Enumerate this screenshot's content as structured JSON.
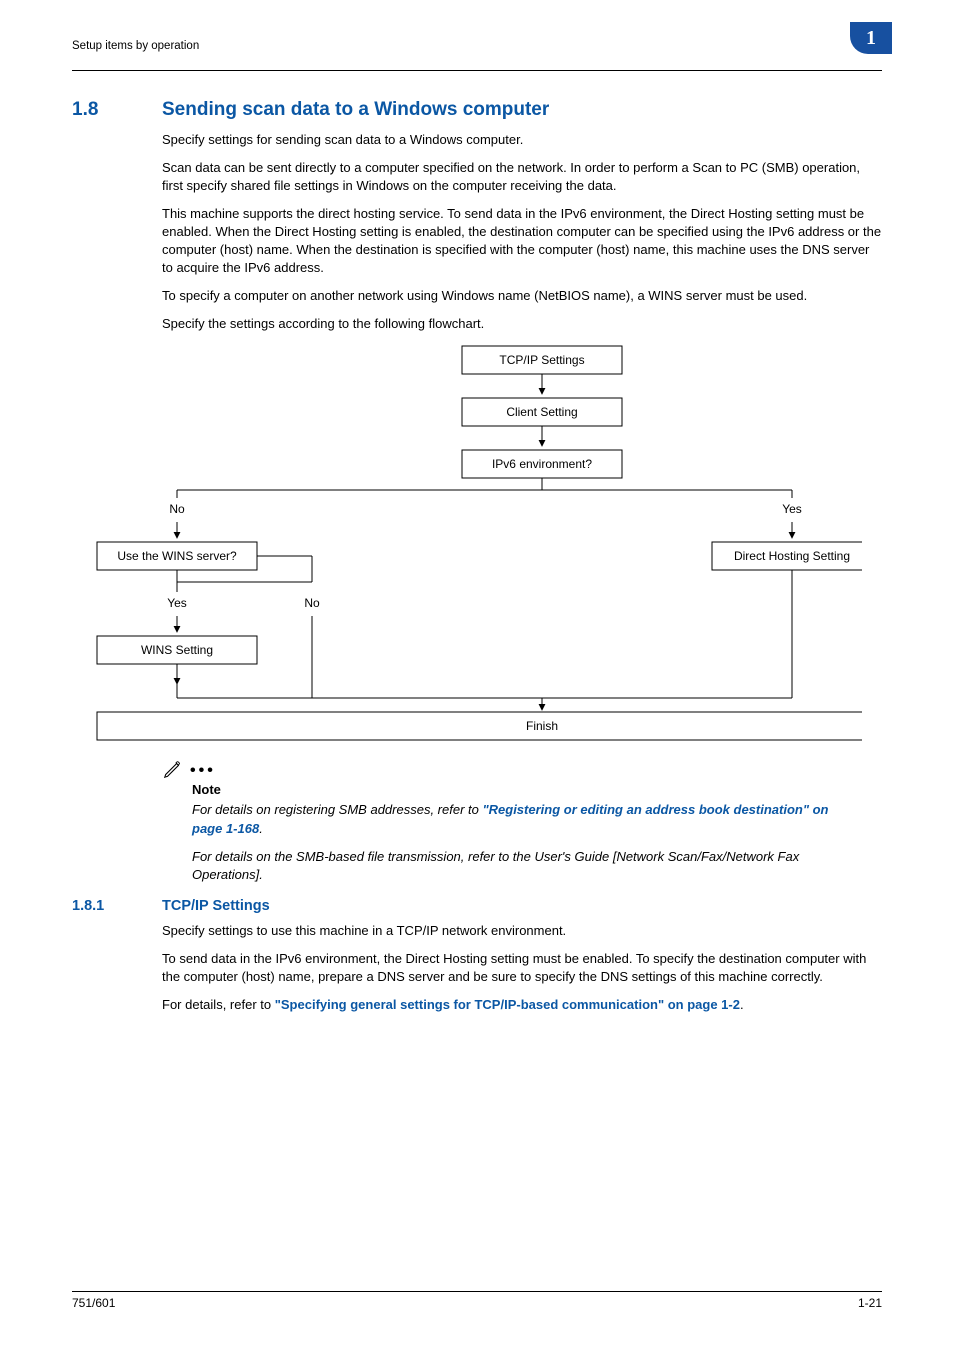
{
  "header": {
    "left": "Setup items by operation",
    "chapter_number": "1"
  },
  "section_18": {
    "num": "1.8",
    "title": "Sending scan data to a Windows computer",
    "p1": "Specify settings for sending scan data to a Windows computer.",
    "p2": "Scan data can be sent directly to a computer specified on the network. In order to perform a Scan to PC (SMB) operation, first specify shared file settings in Windows on the computer receiving the data.",
    "p3": "This machine supports the direct hosting service. To send data in the IPv6 environment, the Direct Hosting setting must be enabled. When the Direct Hosting setting is enabled, the destination computer can be specified using the IPv6 address or the computer (host) name. When the destination is specified with the computer (host) name, this machine uses the DNS server to acquire the IPv6 address.",
    "p4": "To specify a computer on another network using Windows name (NetBIOS name), a WINS server must be used.",
    "p5": "Specify the settings according to the following flowchart."
  },
  "flowchart": {
    "box1": "TCP/IP Settings",
    "box2": "Client Setting",
    "decision": "IPv6 environment?",
    "no1": "No",
    "yes1": "Yes",
    "decision2": "Use the WINS server?",
    "box_direct": "Direct Hosting Setting",
    "yes2": "Yes",
    "no2": "No",
    "box_wins": "WINS Setting",
    "finish": "Finish"
  },
  "note": {
    "label": "Note",
    "n1_pre": "For details on registering SMB addresses, refer to ",
    "n1_link": "\"Registering or editing an address book destination\" on page 1-168",
    "n1_post": ".",
    "n2": "For details on the SMB-based file transmission, refer to the User's Guide [Network Scan/Fax/Network Fax Operations]."
  },
  "section_181": {
    "num": "1.8.1",
    "title": "TCP/IP Settings",
    "p1": "Specify settings to use this machine in a TCP/IP network environment.",
    "p2": "To send data in the IPv6 environment, the Direct Hosting setting must be enabled. To specify the destination computer with the computer (host) name, prepare a DNS server and be sure to specify the DNS settings of this machine correctly.",
    "p3_pre": "For details, refer to ",
    "p3_link": "\"Specifying general settings for TCP/IP-based communication\" on page 1-2",
    "p3_post": "."
  },
  "footer": {
    "left": "751/601",
    "right": "1-21"
  }
}
